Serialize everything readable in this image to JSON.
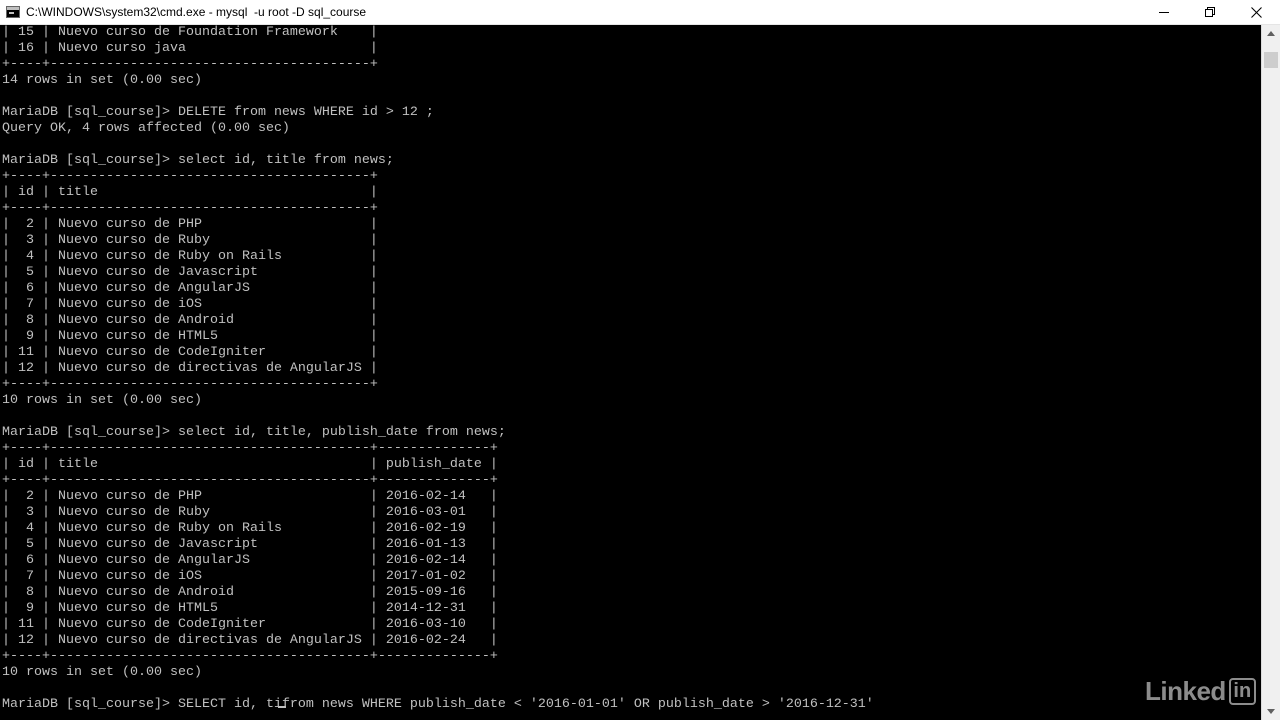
{
  "window": {
    "title": "C:\\WINDOWS\\system32\\cmd.exe - mysql  -u root -D sql_course",
    "icon": "cmd-prompt-icon",
    "controls": [
      "minimize-icon",
      "maximize-icon",
      "close-icon"
    ]
  },
  "terminal": {
    "background": "#000000",
    "foreground": "#c0c0c0",
    "lines": [
      "| 15 | Nuevo curso de Foundation Framework    |",
      "| 16 | Nuevo curso java                       |",
      "+----+----------------------------------------+",
      "14 rows in set (0.00 sec)",
      "",
      "MariaDB [sql_course]> DELETE from news WHERE id > 12 ;",
      "Query OK, 4 rows affected (0.00 sec)",
      "",
      "MariaDB [sql_course]> select id, title from news;",
      "+----+----------------------------------------+",
      "| id | title                                  |",
      "+----+----------------------------------------+",
      "|  2 | Nuevo curso de PHP                     |",
      "|  3 | Nuevo curso de Ruby                    |",
      "|  4 | Nuevo curso de Ruby on Rails           |",
      "|  5 | Nuevo curso de Javascript              |",
      "|  6 | Nuevo curso de AngularJS               |",
      "|  7 | Nuevo curso de iOS                     |",
      "|  8 | Nuevo curso de Android                 |",
      "|  9 | Nuevo curso de HTML5                   |",
      "| 11 | Nuevo curso de CodeIgniter             |",
      "| 12 | Nuevo curso de directivas de AngularJS |",
      "+----+----------------------------------------+",
      "10 rows in set (0.00 sec)",
      "",
      "MariaDB [sql_course]> select id, title, publish_date from news;",
      "+----+----------------------------------------+--------------+",
      "| id | title                                  | publish_date |",
      "+----+----------------------------------------+--------------+",
      "|  2 | Nuevo curso de PHP                     | 2016-02-14   |",
      "|  3 | Nuevo curso de Ruby                    | 2016-03-01   |",
      "|  4 | Nuevo curso de Ruby on Rails           | 2016-02-19   |",
      "|  5 | Nuevo curso de Javascript              | 2016-01-13   |",
      "|  6 | Nuevo curso de AngularJS               | 2016-02-14   |",
      "|  7 | Nuevo curso de iOS                     | 2017-01-02   |",
      "|  8 | Nuevo curso de Android                 | 2015-09-16   |",
      "|  9 | Nuevo curso de HTML5                   | 2014-12-31   |",
      "| 11 | Nuevo curso de CodeIgniter             | 2016-03-10   |",
      "| 12 | Nuevo curso de directivas de AngularJS | 2016-02-24   |",
      "+----+----------------------------------------+--------------+",
      "10 rows in set (0.00 sec)",
      "",
      "MariaDB [sql_course]> SELECT id, ti"
    ],
    "input_after_cursor": "from news WHERE publish_date < '2016-01-01' OR publish_date > '2016-12-31'"
  },
  "scrollbar": {
    "up_icon": "scroll-up-arrow-icon",
    "down_icon": "scroll-down-arrow-icon"
  },
  "watermark": {
    "text": "Linked",
    "box_text": "in"
  }
}
